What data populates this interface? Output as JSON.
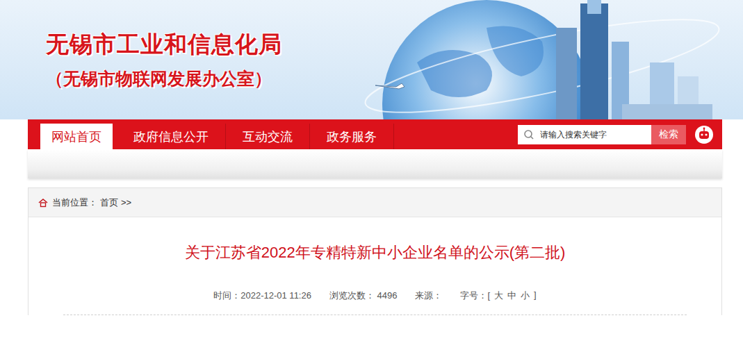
{
  "header": {
    "title": "无锡市工业和信息化局",
    "subtitle": "（无锡市物联网发展办公室）"
  },
  "nav": {
    "items": [
      {
        "label": "网站首页",
        "selected": true
      },
      {
        "label": "政府信息公开",
        "selected": false
      },
      {
        "label": "互动交流",
        "selected": false
      },
      {
        "label": "政务服务",
        "selected": false
      }
    ]
  },
  "search": {
    "placeholder": "请输入搜索关键字",
    "button": "检索"
  },
  "breadcrumb": {
    "label": "当前位置：",
    "items": [
      "首页"
    ],
    "separator": ">>"
  },
  "article": {
    "title": "关于江苏省2022年专精特新中小企业名单的公示(第二批)",
    "meta": {
      "time_label": "时间：",
      "time": "2022-12-01 11:26",
      "views_label": "浏览次数：",
      "views": "4496",
      "source_label": "来源：",
      "font_size_label": "字号：",
      "font_open": "[",
      "font_options": [
        "大",
        "中",
        "小"
      ],
      "font_close": "]"
    }
  }
}
